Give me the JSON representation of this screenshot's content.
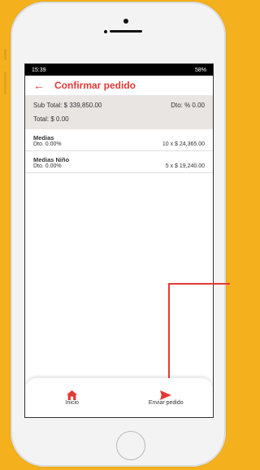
{
  "status": {
    "time": "15:39",
    "right": "58%"
  },
  "header": {
    "title": "Confirmar pedido"
  },
  "summary": {
    "subtotal": "Sub Total: $ 339,850.00",
    "discount": "Dto: % 0.00",
    "total": "Total: $ 0.00"
  },
  "items": [
    {
      "name": "Medias",
      "discount": "Dto. 0.00%",
      "qty_price": "10 x $ 24,365.00"
    },
    {
      "name": "Medias Niño",
      "discount": "Dto. 0.00%",
      "qty_price": "5 x $ 19,240.00"
    }
  ],
  "nav": {
    "home_label": "Inicio",
    "send_label": "Enviar pedido"
  },
  "colors": {
    "accent": "#e53935",
    "background": "#f4b11d"
  }
}
